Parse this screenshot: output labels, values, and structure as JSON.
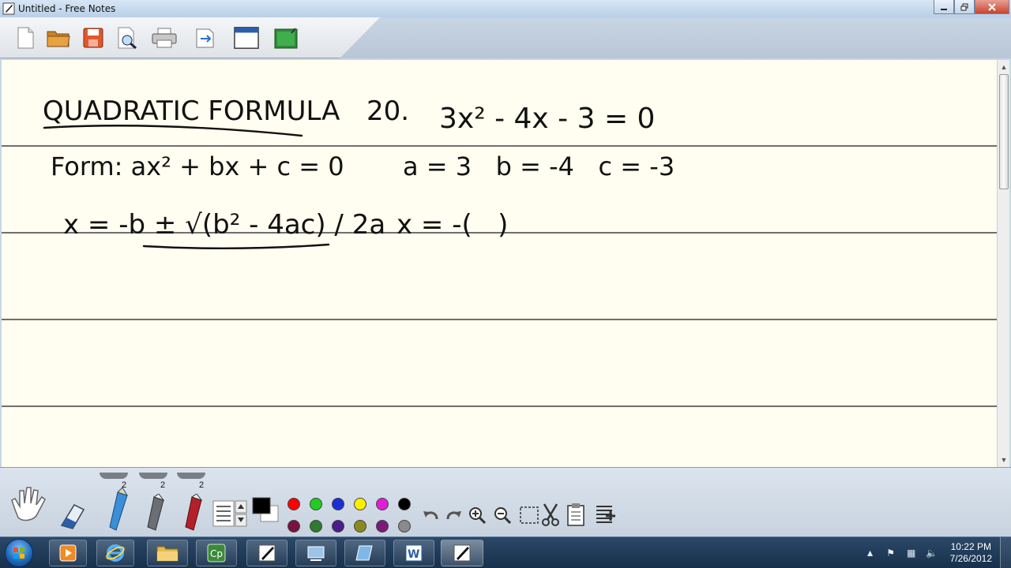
{
  "window": {
    "title": "Untitled - Free Notes"
  },
  "toolbar": {
    "buttons": [
      {
        "name": "new-document",
        "icon": "new-document-icon"
      },
      {
        "name": "open-folder",
        "icon": "folder-icon"
      },
      {
        "name": "save",
        "icon": "floppy-disk-icon"
      },
      {
        "name": "print-preview",
        "icon": "magnifier-document-icon"
      },
      {
        "name": "print",
        "icon": "printer-icon"
      },
      {
        "name": "export",
        "icon": "export-icon"
      },
      {
        "name": "window",
        "icon": "window-icon"
      },
      {
        "name": "presentation",
        "icon": "green-board-icon"
      }
    ]
  },
  "notes": {
    "line1_title": "QUADRATIC FORMULA",
    "line1_problem_number": "20.",
    "line1_equation": "3x² - 4x - 3 = 0",
    "line2_form": "Form: ax² + bx + c = 0",
    "line2_coefficients": "a = 3   b = -4   c = -3",
    "line3_formula": "x = -b ± √(b² - 4ac) / 2a",
    "line3_work": "x = -(   )"
  },
  "pen_panel": {
    "sizes": [
      "2",
      "2",
      "2"
    ],
    "colors_top": [
      "#ff0000",
      "#22cc22",
      "#1a2fd6",
      "#ffee00",
      "#e01ed6",
      "#000000"
    ],
    "colors_bottom": [
      "#7a1040",
      "#2e7a2e",
      "#4b1c8a",
      "#8a8a1e",
      "#7a1a7a",
      "#8a8a8a"
    ],
    "current_color": "#000000"
  },
  "taskbar": {
    "clock_time": "10:22 PM",
    "clock_date": "7/26/2012"
  }
}
